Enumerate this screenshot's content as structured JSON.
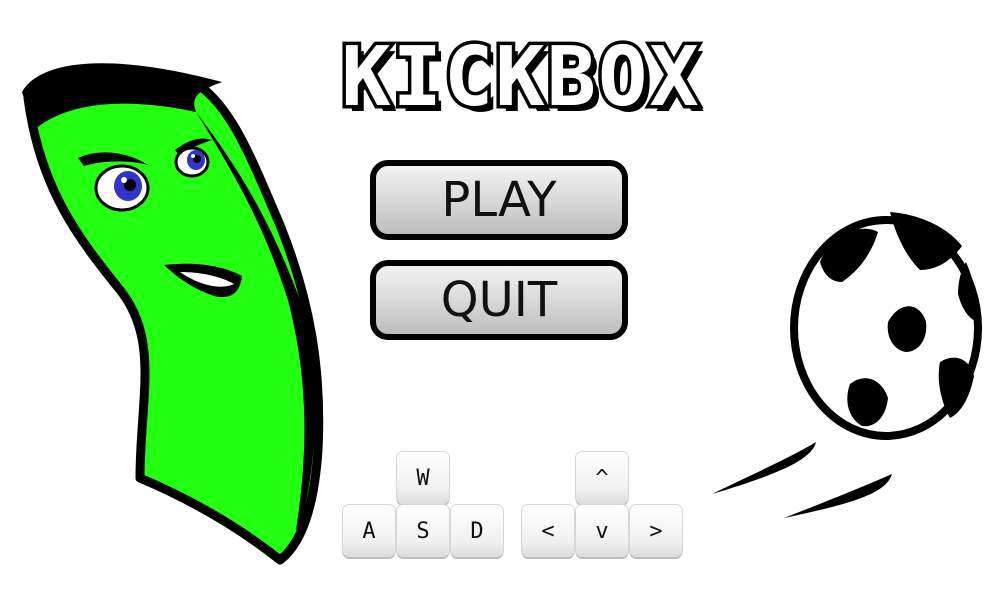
{
  "title": "KICKBOX",
  "menu": {
    "play_label": "PLAY",
    "quit_label": "QUIT"
  },
  "controls": {
    "player1": {
      "up": "W",
      "left": "A",
      "down": "S",
      "right": "D"
    },
    "player2": {
      "up": "^",
      "left": "<",
      "down": "v",
      "right": ">"
    }
  },
  "colors": {
    "character_green": "#22ff11",
    "eye_blue": "#3333cc",
    "outline": "#000000",
    "background": "#ffffff"
  },
  "icons": {
    "character": "green-character-icon",
    "ball": "soccer-ball-icon"
  }
}
